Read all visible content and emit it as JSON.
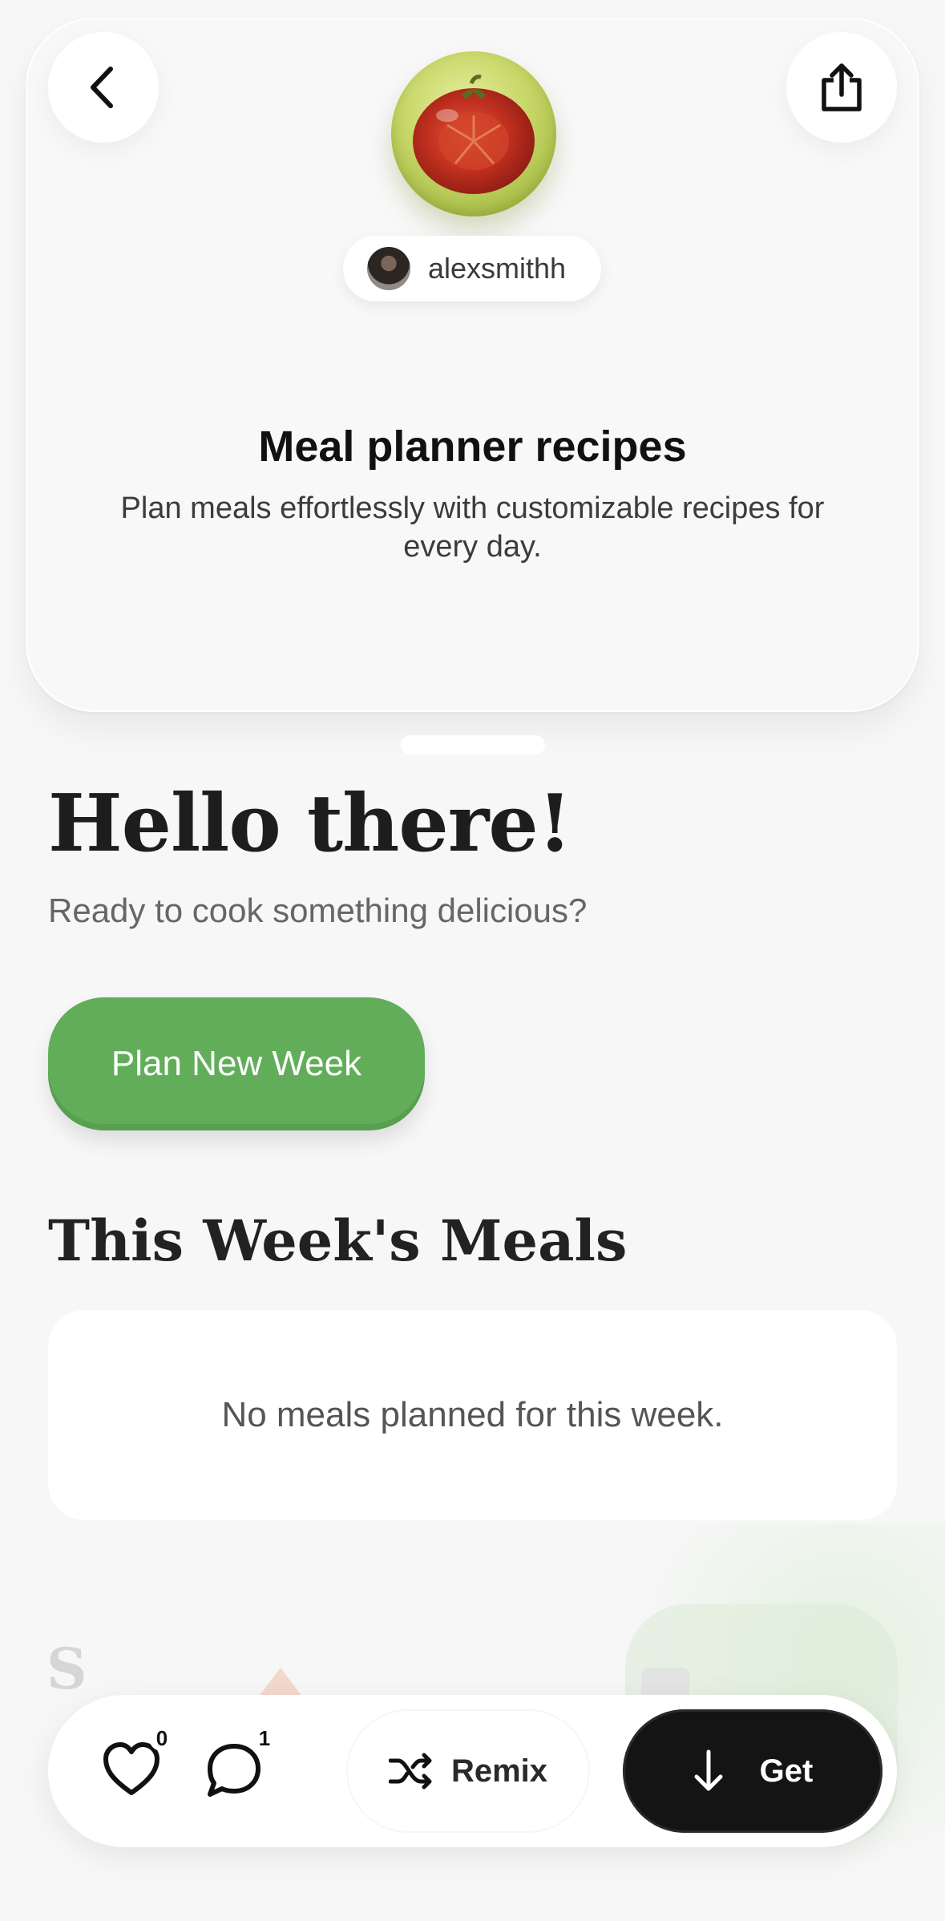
{
  "header": {
    "author": "alexsmithh",
    "app_title": "Meal planner recipes",
    "app_description": "Plan meals effortlessly with customizable recipes for every day."
  },
  "main": {
    "greeting": "Hello there!",
    "subtitle": "Ready to cook something delicious?",
    "plan_button": "Plan New Week",
    "week_heading": "This Week's Meals",
    "empty_message": "No meals planned for this week."
  },
  "bottom_bar": {
    "likes": "0",
    "comments": "1",
    "remix_label": "Remix",
    "get_label": "Get"
  },
  "colors": {
    "accent_green": "#62ad59",
    "dark_button": "#141414",
    "background": "#f7f7f7"
  },
  "icons": [
    "back-arrow-icon",
    "share-icon",
    "tomato-app-icon",
    "heart-icon",
    "comment-icon",
    "shuffle-icon",
    "download-arrow-icon"
  ]
}
